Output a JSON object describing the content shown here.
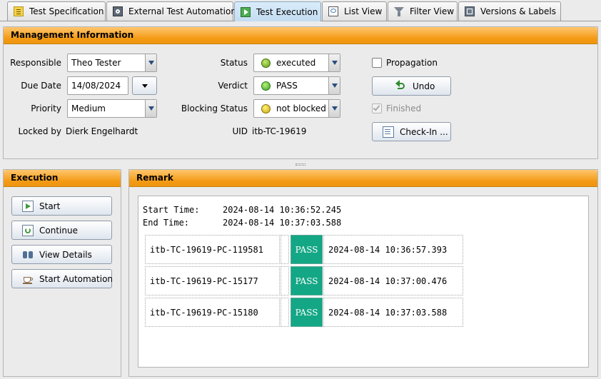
{
  "tabs": [
    {
      "label": "Test Specification",
      "icon": "spec-icon"
    },
    {
      "label": "External Test Automation",
      "icon": "automation-icon"
    },
    {
      "label": "Test Execution",
      "icon": "execution-icon"
    },
    {
      "label": "List View",
      "icon": "list-view-icon"
    },
    {
      "label": "Filter View",
      "icon": "filter-icon"
    },
    {
      "label": "Versions & Labels",
      "icon": "versions-icon"
    }
  ],
  "management": {
    "title": "Management Information",
    "responsible_label": "Responsible",
    "responsible_value": "Theo Tester",
    "due_date_label": "Due Date",
    "due_date_value": "14/08/2024",
    "priority_label": "Priority",
    "priority_value": "Medium",
    "locked_by_label": "Locked by",
    "locked_by_value": "Dierk Engelhardt",
    "status_label": "Status",
    "status_value": "executed",
    "verdict_label": "Verdict",
    "verdict_value": "PASS",
    "blocking_label": "Blocking Status",
    "blocking_value": "not blocked",
    "uid_label": "UID",
    "uid_value": "itb-TC-19619",
    "propagation_label": "Propagation",
    "undo_label": "Undo",
    "finished_label": "Finished",
    "checkin_label": "Check-In ..."
  },
  "execution": {
    "title": "Execution",
    "buttons": [
      "Start",
      "Continue",
      "View Details",
      "Start Automation"
    ]
  },
  "remark": {
    "title": "Remark",
    "start_label": "Start Time:",
    "start_value": "2024-08-14 10:36:52.245",
    "end_label": "End Time:",
    "end_value": "2024-08-14 10:37:03.588",
    "rows": [
      {
        "id": "itb-TC-19619-PC-119581",
        "verdict": "PASS",
        "time": "2024-08-14 10:36:57.393"
      },
      {
        "id": "itb-TC-19619-PC-15177",
        "verdict": "PASS",
        "time": "2024-08-14 10:37:00.476"
      },
      {
        "id": "itb-TC-19619-PC-15180",
        "verdict": "PASS",
        "time": "2024-08-14 10:37:03.588"
      }
    ]
  },
  "colors": {
    "header_orange": "#f39a14",
    "pass_green": "#14a785"
  }
}
